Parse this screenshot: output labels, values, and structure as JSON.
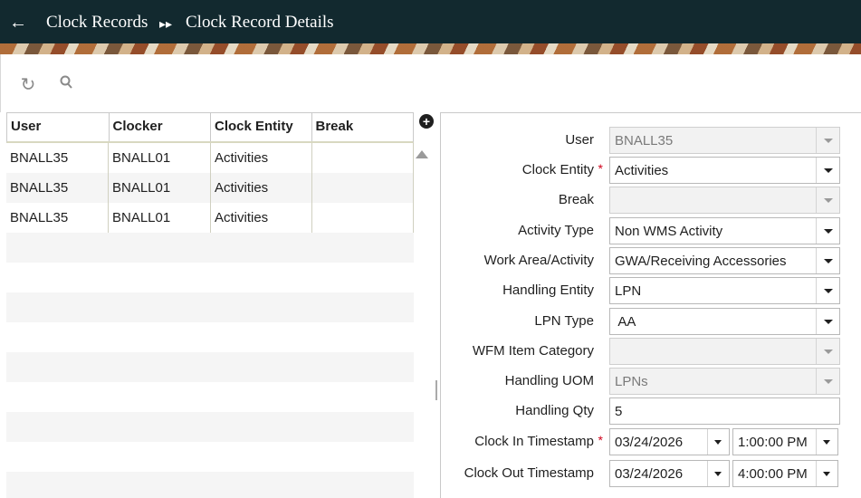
{
  "header": {
    "back_icon": "back-arrow-icon",
    "breadcrumb": [
      "Clock Records",
      "Clock Record Details"
    ],
    "separator_icon": "double-chevron-right-icon"
  },
  "toolbar": {
    "icons": [
      "refresh-icon",
      "search-icon"
    ]
  },
  "grid": {
    "columns": [
      "User",
      "Clocker",
      "Clock Entity",
      "Break"
    ],
    "rows": [
      [
        "BNALL35",
        "BNALL01",
        "Activities",
        ""
      ],
      [
        "BNALL35",
        "BNALL01",
        "Activities",
        ""
      ],
      [
        "BNALL35",
        "BNALL01",
        "Activities",
        ""
      ]
    ],
    "add_icon": "add-circle-icon"
  },
  "form": {
    "user": {
      "label": "User",
      "value": "BNALL35"
    },
    "clock_entity": {
      "label": "Clock Entity",
      "value": "Activities",
      "required_mark": "*"
    },
    "break": {
      "label": "Break",
      "value": ""
    },
    "activity_type": {
      "label": "Activity Type",
      "value": "Non WMS Activity"
    },
    "work_area": {
      "label": "Work Area/Activity",
      "value": "GWA/Receiving Accessories"
    },
    "handling_entity": {
      "label": "Handling Entity",
      "value": "LPN"
    },
    "lpn_type": {
      "label": "LPN Type",
      "value": " AA"
    },
    "wfm_item_category": {
      "label": "WFM Item Category",
      "value": ""
    },
    "handling_uom": {
      "label": "Handling UOM",
      "value": "LPNs"
    },
    "handling_qty": {
      "label": "Handling Qty",
      "value": "5"
    },
    "clock_in": {
      "label": "Clock In Timestamp",
      "required_mark": "*",
      "date": "03/24/2026",
      "time": "1:00:00 PM"
    },
    "clock_out": {
      "label": "Clock Out Timestamp",
      "date": "03/24/2026",
      "time": "4:00:00 PM"
    }
  },
  "colors": {
    "header_bg": "#12292f",
    "required": "#d0021b"
  }
}
